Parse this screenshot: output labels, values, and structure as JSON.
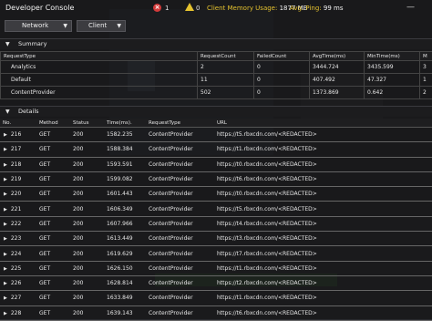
{
  "window": {
    "title": "Developer Console",
    "minimize_glyph": "—"
  },
  "status": {
    "error_count": "1",
    "warning_count": "0",
    "memory_label": "Client Memory Usage:",
    "memory_value": "1877 MB",
    "ping_label": "Avg. Ping:",
    "ping_value": "99 ms",
    "colors": {
      "error": "#d23a3a",
      "warning": "#e5c22f"
    }
  },
  "dropdowns": {
    "view": "Network",
    "target": "Client"
  },
  "summary": {
    "label": "Summary",
    "columns": [
      "RequestType",
      "RequestCount",
      "FailedCount",
      "AvgTime(ms)",
      "MinTime(ms)",
      "M"
    ],
    "rows": [
      [
        "Analytics",
        "2",
        "0",
        "3444.724",
        "3435.599",
        "3"
      ],
      [
        "Default",
        "11",
        "0",
        "407.492",
        "47.327",
        "1"
      ],
      [
        "ContentProvider",
        "502",
        "0",
        "1373.869",
        "0.642",
        "2"
      ]
    ]
  },
  "details": {
    "label": "Details",
    "columns": [
      "No.",
      "Method",
      "Status",
      "Time(ms).",
      "RequestType",
      "URL"
    ],
    "rows": [
      [
        "216",
        "GET",
        "200",
        "1582.235",
        "ContentProvider",
        "https://t5.rbxcdn.com/<REDACTED>"
      ],
      [
        "217",
        "GET",
        "200",
        "1588.384",
        "ContentProvider",
        "https://t1.rbxcdn.com/<REDACTED>"
      ],
      [
        "218",
        "GET",
        "200",
        "1593.591",
        "ContentProvider",
        "https://t0.rbxcdn.com/<REDACTED>"
      ],
      [
        "219",
        "GET",
        "200",
        "1599.082",
        "ContentProvider",
        "https://t6.rbxcdn.com/<REDACTED>"
      ],
      [
        "220",
        "GET",
        "200",
        "1601.443",
        "ContentProvider",
        "https://t0.rbxcdn.com/<REDACTED>"
      ],
      [
        "221",
        "GET",
        "200",
        "1606.349",
        "ContentProvider",
        "https://t5.rbxcdn.com/<REDACTED>"
      ],
      [
        "222",
        "GET",
        "200",
        "1607.966",
        "ContentProvider",
        "https://t4.rbxcdn.com/<REDACTED>"
      ],
      [
        "223",
        "GET",
        "200",
        "1613.449",
        "ContentProvider",
        "https://t3.rbxcdn.com/<REDACTED>"
      ],
      [
        "224",
        "GET",
        "200",
        "1619.629",
        "ContentProvider",
        "https://t7.rbxcdn.com/<REDACTED>"
      ],
      [
        "225",
        "GET",
        "200",
        "1626.150",
        "ContentProvider",
        "https://t1.rbxcdn.com/<REDACTED>"
      ],
      [
        "226",
        "GET",
        "200",
        "1628.814",
        "ContentProvider",
        "https://t2.rbxcdn.com/<REDACTED>"
      ],
      [
        "227",
        "GET",
        "200",
        "1633.849",
        "ContentProvider",
        "https://t1.rbxcdn.com/<REDACTED>"
      ],
      [
        "228",
        "GET",
        "200",
        "1639.143",
        "ContentProvider",
        "https://t6.rbxcdn.com/<REDACTED>"
      ]
    ]
  }
}
